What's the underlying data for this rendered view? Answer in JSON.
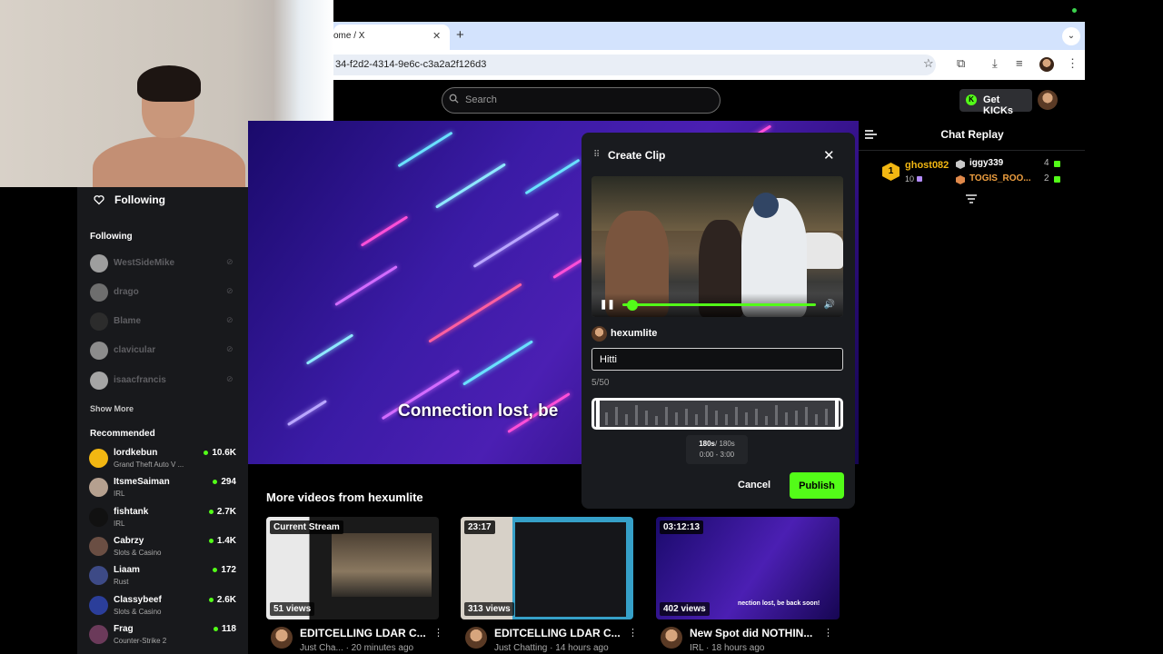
{
  "browser": {
    "tab_title": "ome / X",
    "tab_close": "✕",
    "new_tab": "+",
    "url": "34-f2d2-4314-9e6c-c3a2a2f126d3"
  },
  "header": {
    "search_placeholder": "Search",
    "get_kicks": "Get KICKs"
  },
  "sidebar": {
    "following_nav": "Following",
    "following_section": "Following",
    "following": [
      {
        "name": "WestSideMike"
      },
      {
        "name": "drago"
      },
      {
        "name": "Blame"
      },
      {
        "name": "clavicular"
      },
      {
        "name": "isaacfrancis"
      }
    ],
    "show_more": "Show More",
    "recommended_section": "Recommended",
    "recommended": [
      {
        "name": "lordkebun",
        "category": "Grand Theft Auto V ...",
        "viewers": "10.6K"
      },
      {
        "name": "ItsmeSaiman",
        "category": "IRL",
        "viewers": "294"
      },
      {
        "name": "fishtank",
        "category": "IRL",
        "viewers": "2.7K"
      },
      {
        "name": "Cabrzy",
        "category": "Slots & Casino",
        "viewers": "1.4K"
      },
      {
        "name": "Liaam",
        "category": "Rust",
        "viewers": "172"
      },
      {
        "name": "Classybeef",
        "category": "Slots & Casino",
        "viewers": "2.6K"
      },
      {
        "name": "Frag",
        "category": "Counter-Strike 2",
        "viewers": "118"
      }
    ]
  },
  "player": {
    "overlay_text": "Connection lost, be"
  },
  "chat": {
    "title": "Chat Replay",
    "leaderboard": [
      {
        "rank": "1",
        "name": "ghost082",
        "points": "10"
      },
      {
        "name": "iggy339",
        "points": "4"
      },
      {
        "name": "TOGIS_ROO...",
        "points": "2"
      }
    ]
  },
  "clip_modal": {
    "title": "Create Clip",
    "username": "hexumlite",
    "title_value": "Hitti",
    "char_count": "5/50",
    "duration_selected": "180s",
    "duration_max": "/ 180s",
    "range": "0:00 - 3:00",
    "cancel": "Cancel",
    "publish": "Publish",
    "playback_progress": 0.05
  },
  "more_videos": {
    "title": "More videos from hexumlite",
    "cards": [
      {
        "badge": "Current Stream",
        "views": "51 views",
        "title": "EDITCELLING LDAR C...",
        "meta": "Just Cha... · 20 minutes ago"
      },
      {
        "badge": "23:17",
        "views": "313 views",
        "title": "EDITCELLING LDAR C...",
        "meta": "Just Chatting · 14 hours ago"
      },
      {
        "badge": "03:12:13",
        "views": "402 views",
        "title": "New Spot did NOTHIN...",
        "meta": "IRL · 18 hours ago",
        "thumb_text": "nection lost, be back soon!"
      }
    ]
  },
  "colors": {
    "accent": "#53fc18",
    "gold": "#f2b712",
    "orange": "#f0a040"
  }
}
